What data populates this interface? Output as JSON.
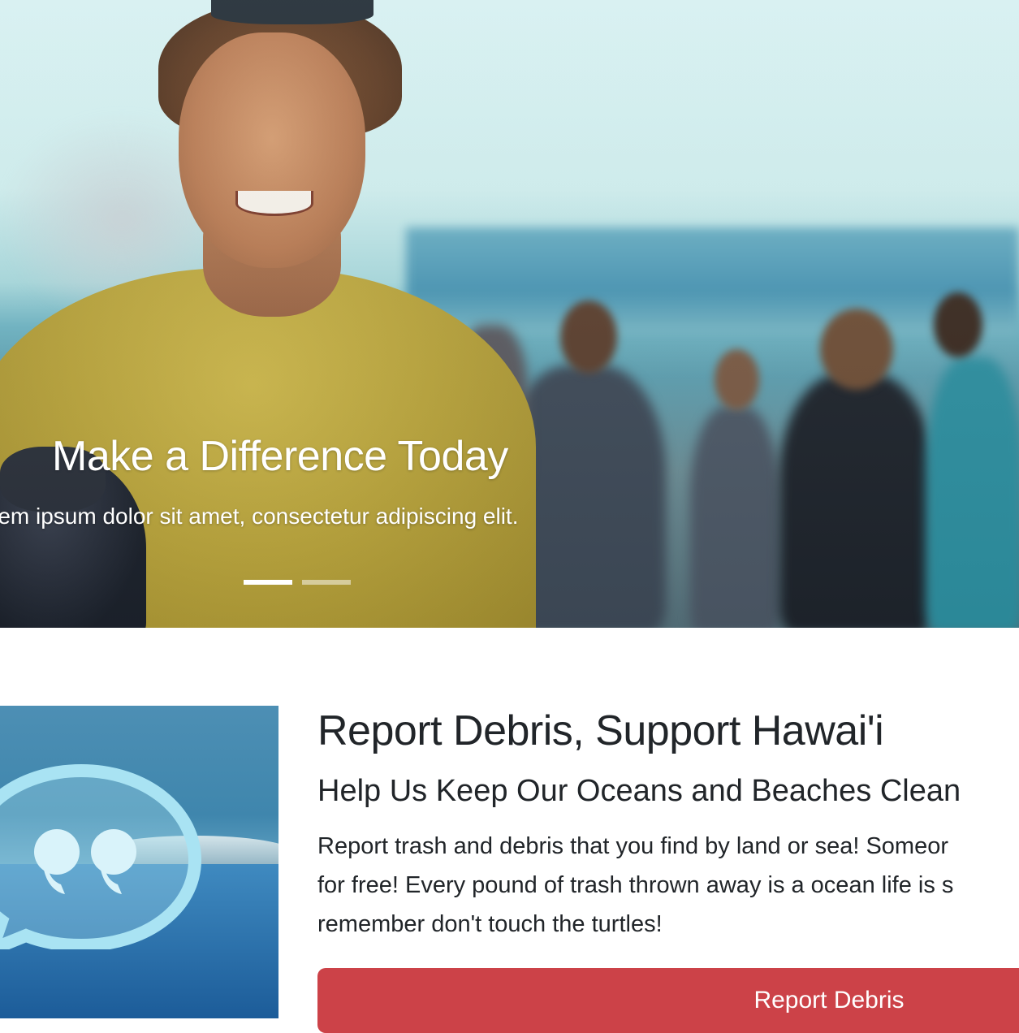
{
  "hero": {
    "caption_title": "Make a Difference Today",
    "caption_text": "rem ipsum dolor sit amet, consectetur adipiscing elit.",
    "slides": 2,
    "active_slide": 1
  },
  "feature": {
    "title": "Report Debris, Support Hawai'i",
    "subtitle": "Help Us Keep Our Oceans and Beaches Clean",
    "text_lines": [
      "Report trash and debris that you find by land or sea! Someor",
      "for free! Every pound of trash thrown away is a ocean life is s",
      "remember don't touch the turtles!"
    ],
    "button_label": "Report Debris"
  },
  "colors": {
    "button": "#cc4248",
    "text": "#212529",
    "caption": "#ffffff"
  },
  "icons": [
    "quote-bubble-icon"
  ]
}
